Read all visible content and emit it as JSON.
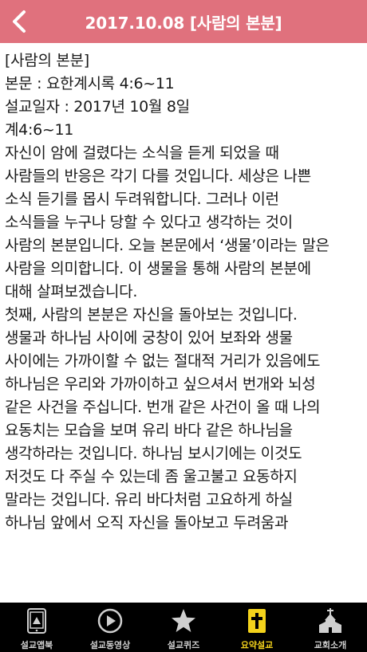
{
  "header": {
    "title": "2017.10.08 [사람의 본분]",
    "back_icon": "chevron-left-icon",
    "bg_color": "#e0717d"
  },
  "content": {
    "lines": [
      "[사람의 본분]",
      "본문 : 요한계시록 4:6~11",
      "설교일자 : 2017년 10월 8일",
      "",
      "계4:6~11",
      "",
      "자신이 암에 걸렸다는 소식을 듣게 되었을 때",
      "사람들의 반응은 각기 다를 것입니다. 세상은 나쁜",
      "소식 듣기를 몹시 두려워합니다. 그러나 이런",
      "소식들을 누구나 당할 수 있다고 생각하는 것이",
      "사람의 본분입니다. 오늘 본문에서 ‘생물’이라는 말은",
      "사람을 의미합니다. 이 생물을 통해 사람의 본분에",
      "대해 살펴보겠습니다.",
      "",
      "",
      "첫째, 사람의 본분은 자신을 돌아보는 것입니다.",
      "",
      "생물과 하나님 사이에 궁창이 있어 보좌와 생물",
      "사이에는 가까이할 수 없는 절대적 거리가 있음에도",
      "하나님은 우리와 가까이하고 싶으셔서 번개와 뇌성",
      "같은 사건을 주십니다. 번개 같은 사건이 올 때 나의",
      "요동치는 모습을 보며 유리 바다 같은 하나님을",
      "생각하라는 것입니다. 하나님 보시기에는 이것도",
      "저것도 다 주실 수 있는데 좀 울고불고 요동하지",
      "말라는 것입니다. 유리 바다처럼 고요하게 하실",
      "하나님 앞에서 오직 자신을 돌아보고 두려움과"
    ]
  },
  "tabbar": {
    "active_color": "#f3d21b",
    "tabs": [
      {
        "label": "설교앱북",
        "icon": "phone-book-icon",
        "active": false
      },
      {
        "label": "설교동영상",
        "icon": "play-circle-icon",
        "active": false
      },
      {
        "label": "설교퀴즈",
        "icon": "star-icon",
        "active": false
      },
      {
        "label": "요약설교",
        "icon": "cross-book-icon",
        "active": true
      },
      {
        "label": "교회소개",
        "icon": "church-icon",
        "active": false
      }
    ]
  }
}
